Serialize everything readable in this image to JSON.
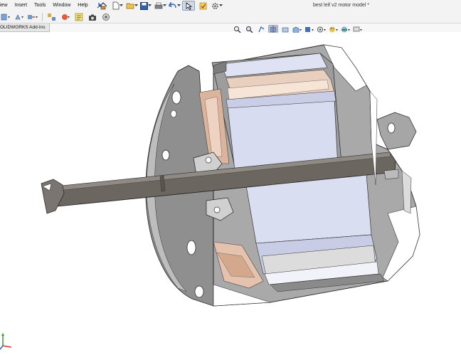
{
  "menubar": {
    "items": [
      "View",
      "Insert",
      "Tools",
      "Window",
      "Help"
    ],
    "visible_items": [
      "iew",
      "Insert",
      "Tools",
      "Window",
      "Help"
    ],
    "pin_icon": "pin-icon"
  },
  "quick_access": {
    "icons": [
      "home-icon",
      "new-document-icon",
      "open-folder-icon",
      "save-icon",
      "print-icon",
      "undo-icon",
      "select-arrow-icon",
      "rebuild-icon",
      "options-gear-icon"
    ]
  },
  "document": {
    "title": "best leif v2 motor model *"
  },
  "tabs": {
    "active_label": "OLIDWORKS Add-Ins"
  },
  "colors": {
    "accent": "#1f67b1",
    "menubar_bg": "#f3f3f3",
    "model_gray": "#9a9a9a",
    "model_light": "#dcdfee",
    "copper": "#e8c9b4"
  }
}
